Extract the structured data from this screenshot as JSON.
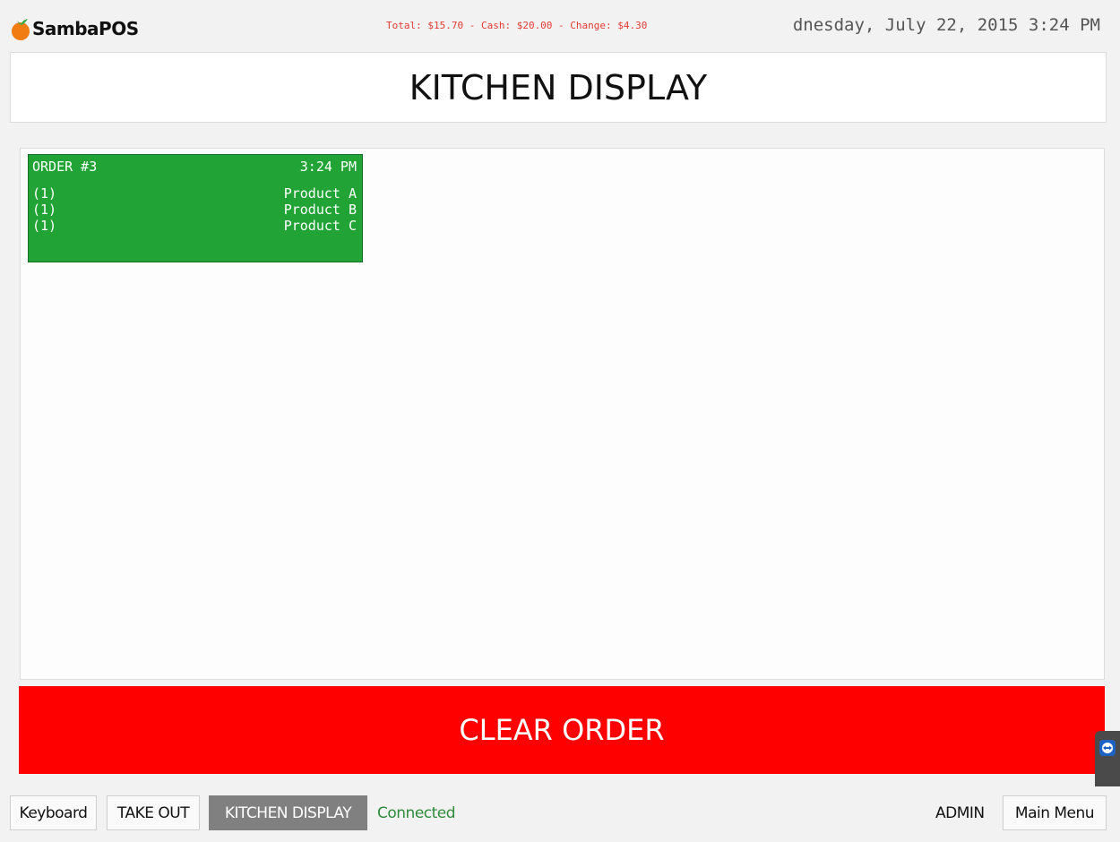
{
  "app": {
    "logo_text": "SambaPOS"
  },
  "status": {
    "totals": "Total: $15.70 - Cash: $20.00 - Change: $4.30",
    "datetime": "dnesday, July 22, 2015 3:24 PM"
  },
  "header": {
    "title": "KITCHEN DISPLAY"
  },
  "orders": [
    {
      "title": "ORDER #3",
      "time": "3:24 PM",
      "color": "#21a336",
      "items": [
        {
          "qty": "(1)",
          "name": "Product A"
        },
        {
          "qty": "(1)",
          "name": "Product B"
        },
        {
          "qty": "(1)",
          "name": "Product C"
        }
      ]
    }
  ],
  "actions": {
    "clear_order_label": "CLEAR ORDER",
    "clear_order_color": "#ff0000"
  },
  "bottombar": {
    "keyboard_label": "Keyboard",
    "take_out_label": "TAKE OUT",
    "kitchen_display_label": "KITCHEN DISPLAY",
    "connection_status": "Connected",
    "connection_color": "#2e8b3a",
    "user": "ADMIN",
    "main_menu_label": "Main Menu"
  },
  "icons": {
    "logo": "tomato-icon",
    "side_tab": "remote-support-icon"
  }
}
